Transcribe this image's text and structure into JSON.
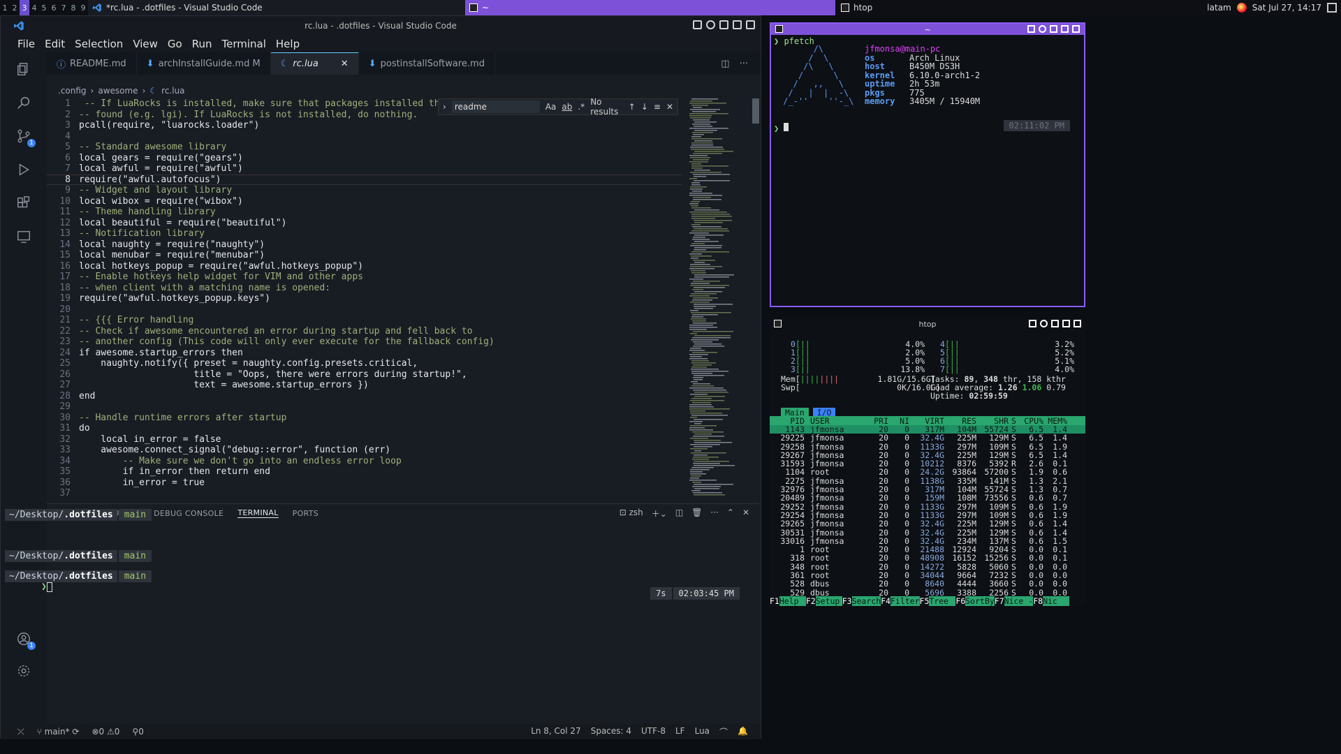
{
  "topbar": {
    "workspaces": [
      "1",
      "2",
      "3",
      "4",
      "5",
      "6",
      "7",
      "8",
      "9"
    ],
    "active_workspace": "3",
    "task1": "*rc.lua - .dotfiles - Visual Studio Code",
    "task2": "~",
    "task3": "htop",
    "user": "latam",
    "datetime": "Sat Jul 27, 14:17"
  },
  "vscode": {
    "title": "rc.lua - .dotfiles - Visual Studio Code",
    "menu": [
      "File",
      "Edit",
      "Selection",
      "View",
      "Go",
      "Run",
      "Terminal",
      "Help"
    ],
    "tabs": [
      {
        "label": "README.md",
        "icon": "info-icon"
      },
      {
        "label": "archInstallGuide.md M",
        "icon": "markdown-icon"
      },
      {
        "label": "rc.lua",
        "icon": "lua-icon"
      },
      {
        "label": "postinstallSoftware.md",
        "icon": "markdown-icon"
      }
    ],
    "breadcrumb": [
      ".config",
      "awesome",
      "rc.lua"
    ],
    "find": {
      "value": "readme",
      "aa": "Aa",
      "ab": "ab",
      "re": ".*",
      "result": "No results"
    },
    "code": [
      {
        "n": "1",
        "t": " -- If LuaRocks is installed, make sure that packages installed through i",
        "c": "comment"
      },
      {
        "n": "2",
        "t": "-- found (e.g. lgi). If LuaRocks is not installed, do nothing.",
        "c": "comment"
      },
      {
        "n": "3",
        "t": "pcall(require, \"luarocks.loader\")",
        "c": ""
      },
      {
        "n": "4",
        "t": "",
        "c": ""
      },
      {
        "n": "5",
        "t": "-- Standard awesome library",
        "c": "comment"
      },
      {
        "n": "6",
        "t": "local gears = require(\"gears\")",
        "c": ""
      },
      {
        "n": "7",
        "t": "local awful = require(\"awful\")",
        "c": ""
      },
      {
        "n": "8",
        "t": "require(\"awful.autofocus\")",
        "c": ""
      },
      {
        "n": "9",
        "t": "-- Widget and layout library",
        "c": "comment"
      },
      {
        "n": "10",
        "t": "local wibox = require(\"wibox\")",
        "c": ""
      },
      {
        "n": "11",
        "t": "-- Theme handling library",
        "c": "comment"
      },
      {
        "n": "12",
        "t": "local beautiful = require(\"beautiful\")",
        "c": ""
      },
      {
        "n": "13",
        "t": "-- Notification library",
        "c": "comment"
      },
      {
        "n": "14",
        "t": "local naughty = require(\"naughty\")",
        "c": ""
      },
      {
        "n": "15",
        "t": "local menubar = require(\"menubar\")",
        "c": ""
      },
      {
        "n": "16",
        "t": "local hotkeys_popup = require(\"awful.hotkeys_popup\")",
        "c": ""
      },
      {
        "n": "17",
        "t": "-- Enable hotkeys help widget for VIM and other apps",
        "c": "comment"
      },
      {
        "n": "18",
        "t": "-- when client with a matching name is opened:",
        "c": "comment"
      },
      {
        "n": "19",
        "t": "require(\"awful.hotkeys_popup.keys\")",
        "c": ""
      },
      {
        "n": "20",
        "t": "",
        "c": ""
      },
      {
        "n": "21",
        "t": "-- {{{ Error handling",
        "c": "comment"
      },
      {
        "n": "22",
        "t": "-- Check if awesome encountered an error during startup and fell back to",
        "c": "comment"
      },
      {
        "n": "23",
        "t": "-- another config (This code will only ever execute for the fallback config)",
        "c": "comment"
      },
      {
        "n": "24",
        "t": "if awesome.startup_errors then",
        "c": ""
      },
      {
        "n": "25",
        "t": "    naughty.notify({ preset = naughty.config.presets.critical,",
        "c": ""
      },
      {
        "n": "26",
        "t": "                     title = \"Oops, there were errors during startup!\",",
        "c": ""
      },
      {
        "n": "27",
        "t": "                     text = awesome.startup_errors })",
        "c": ""
      },
      {
        "n": "28",
        "t": "end",
        "c": ""
      },
      {
        "n": "29",
        "t": "",
        "c": ""
      },
      {
        "n": "30",
        "t": "-- Handle runtime errors after startup",
        "c": "comment"
      },
      {
        "n": "31",
        "t": "do",
        "c": ""
      },
      {
        "n": "32",
        "t": "    local in_error = false",
        "c": ""
      },
      {
        "n": "33",
        "t": "    awesome.connect_signal(\"debug::error\", function (err)",
        "c": ""
      },
      {
        "n": "34",
        "t": "        -- Make sure we don't go into an endless error loop",
        "c": "comment"
      },
      {
        "n": "35",
        "t": "        if in_error then return end",
        "c": ""
      },
      {
        "n": "36",
        "t": "        in_error = true",
        "c": ""
      },
      {
        "n": "37",
        "t": "",
        "c": ""
      }
    ],
    "current_line": "8",
    "panel_tabs": [
      "PROBLEMS",
      "OUTPUT",
      "DEBUG CONSOLE",
      "TERMINAL",
      "PORTS"
    ],
    "active_panel_tab": "TERMINAL",
    "shell": "zsh",
    "prompt_path_prefix": "~/Desktop/",
    "prompt_path_dir": ".dotfiles",
    "prompt_branch": "main",
    "rprompt_duration": "7s",
    "rprompt_time": "02:03:45 PM",
    "status": {
      "branch": "main*",
      "problems": "0",
      "warnings": "0",
      "ports": "0",
      "position": "Ln 8, Col 27",
      "spaces": "Spaces: 4",
      "encoding": "UTF-8",
      "eol": "LF",
      "language": "Lua"
    },
    "activity_badges": {
      "scm": "1",
      "accounts": "1"
    }
  },
  "pfetch": {
    "title": "~",
    "command": "pfetch",
    "user": "jfmonsa@main-pc",
    "fields": [
      {
        "k": "os",
        "v": "Arch Linux"
      },
      {
        "k": "host",
        "v": "B450M DS3H"
      },
      {
        "k": "kernel",
        "v": "6.10.0-arch1-2"
      },
      {
        "k": "uptime",
        "v": "2h 53m"
      },
      {
        "k": "pkgs",
        "v": "775"
      },
      {
        "k": "memory",
        "v": "3405M / 15940M"
      }
    ],
    "time": "02:11:02 PM"
  },
  "htop": {
    "title": "htop",
    "cpus_left": [
      {
        "id": "0",
        "val": "4.0%"
      },
      {
        "id": "1",
        "val": "2.0%"
      },
      {
        "id": "2",
        "val": "5.0%"
      },
      {
        "id": "3",
        "val": "13.8%"
      }
    ],
    "cpus_right": [
      {
        "id": "4",
        "val": "3.2%"
      },
      {
        "id": "5",
        "val": "5.2%"
      },
      {
        "id": "6",
        "val": "5.1%"
      },
      {
        "id": "7",
        "val": "4.0%"
      }
    ],
    "mem": "1.81G/15.6G",
    "swp": "0K/16.0G",
    "tasks": "89",
    "threads": "348",
    "kthr": "158",
    "load1": "1.26",
    "load5": "1.06",
    "load15": "0.79",
    "uptime": "02:59:59",
    "tabs": [
      "Main",
      "I/O"
    ],
    "headers": [
      "PID",
      "USER",
      "PRI",
      "NI",
      "VIRT",
      "RES",
      "SHR",
      "S",
      "CPU%",
      "MEM%"
    ],
    "rows": [
      [
        "1143",
        "jfmonsa",
        "20",
        "0",
        "317M",
        "104M",
        "55724",
        "S",
        "6.5",
        "1.4"
      ],
      [
        "29225",
        "jfmonsa",
        "20",
        "0",
        "32.4G",
        "225M",
        "129M",
        "S",
        "6.5",
        "1.4"
      ],
      [
        "29258",
        "jfmonsa",
        "20",
        "0",
        "1133G",
        "297M",
        "109M",
        "S",
        "6.5",
        "1.9"
      ],
      [
        "29267",
        "jfmonsa",
        "20",
        "0",
        "32.4G",
        "225M",
        "129M",
        "S",
        "6.5",
        "1.4"
      ],
      [
        "31593",
        "jfmonsa",
        "20",
        "0",
        "10212",
        "8376",
        "5392",
        "R",
        "2.6",
        "0.1"
      ],
      [
        "1104",
        "root",
        "20",
        "0",
        "24.2G",
        "93864",
        "57200",
        "S",
        "1.9",
        "0.6"
      ],
      [
        "2275",
        "jfmonsa",
        "20",
        "0",
        "1138G",
        "335M",
        "141M",
        "S",
        "1.3",
        "2.1"
      ],
      [
        "32976",
        "jfmonsa",
        "20",
        "0",
        "317M",
        "104M",
        "55724",
        "S",
        "1.3",
        "0.7"
      ],
      [
        "20489",
        "jfmonsa",
        "20",
        "0",
        "159M",
        "108M",
        "73556",
        "S",
        "0.6",
        "0.7"
      ],
      [
        "29252",
        "jfmonsa",
        "20",
        "0",
        "1133G",
        "297M",
        "109M",
        "S",
        "0.6",
        "1.9"
      ],
      [
        "29254",
        "jfmonsa",
        "20",
        "0",
        "1133G",
        "297M",
        "109M",
        "S",
        "0.6",
        "1.9"
      ],
      [
        "29265",
        "jfmonsa",
        "20",
        "0",
        "32.4G",
        "225M",
        "129M",
        "S",
        "0.6",
        "1.4"
      ],
      [
        "30531",
        "jfmonsa",
        "20",
        "0",
        "32.4G",
        "225M",
        "129M",
        "S",
        "0.6",
        "1.4"
      ],
      [
        "33016",
        "jfmonsa",
        "20",
        "0",
        "32.4G",
        "234M",
        "137M",
        "S",
        "0.6",
        "1.5"
      ],
      [
        "1",
        "root",
        "20",
        "0",
        "21488",
        "12924",
        "9204",
        "S",
        "0.0",
        "0.1"
      ],
      [
        "318",
        "root",
        "20",
        "0",
        "48908",
        "16152",
        "15256",
        "S",
        "0.0",
        "0.1"
      ],
      [
        "348",
        "root",
        "20",
        "0",
        "14272",
        "5828",
        "5060",
        "S",
        "0.0",
        "0.0"
      ],
      [
        "361",
        "root",
        "20",
        "0",
        "34044",
        "9664",
        "7232",
        "S",
        "0.0",
        "0.0"
      ],
      [
        "528",
        "dbus",
        "20",
        "0",
        "8640",
        "4444",
        "3660",
        "S",
        "0.0",
        "0.0"
      ],
      [
        "529",
        "dbus",
        "20",
        "0",
        "5696",
        "3388",
        "2256",
        "S",
        "0.0",
        "0.0"
      ]
    ],
    "fkeys": [
      {
        "k": "F1",
        "l": "Help"
      },
      {
        "k": "F2",
        "l": "Setup"
      },
      {
        "k": "F3",
        "l": "Search"
      },
      {
        "k": "F4",
        "l": "Filter"
      },
      {
        "k": "F5",
        "l": "Tree"
      },
      {
        "k": "F6",
        "l": "SortBy"
      },
      {
        "k": "F7",
        "l": "Nice -"
      },
      {
        "k": "F8",
        "l": "Nic"
      }
    ]
  },
  "colors": {
    "accent": "#7d52d8",
    "htop_green": "#2aa66f",
    "vscode_blue": "#3b82f6"
  }
}
